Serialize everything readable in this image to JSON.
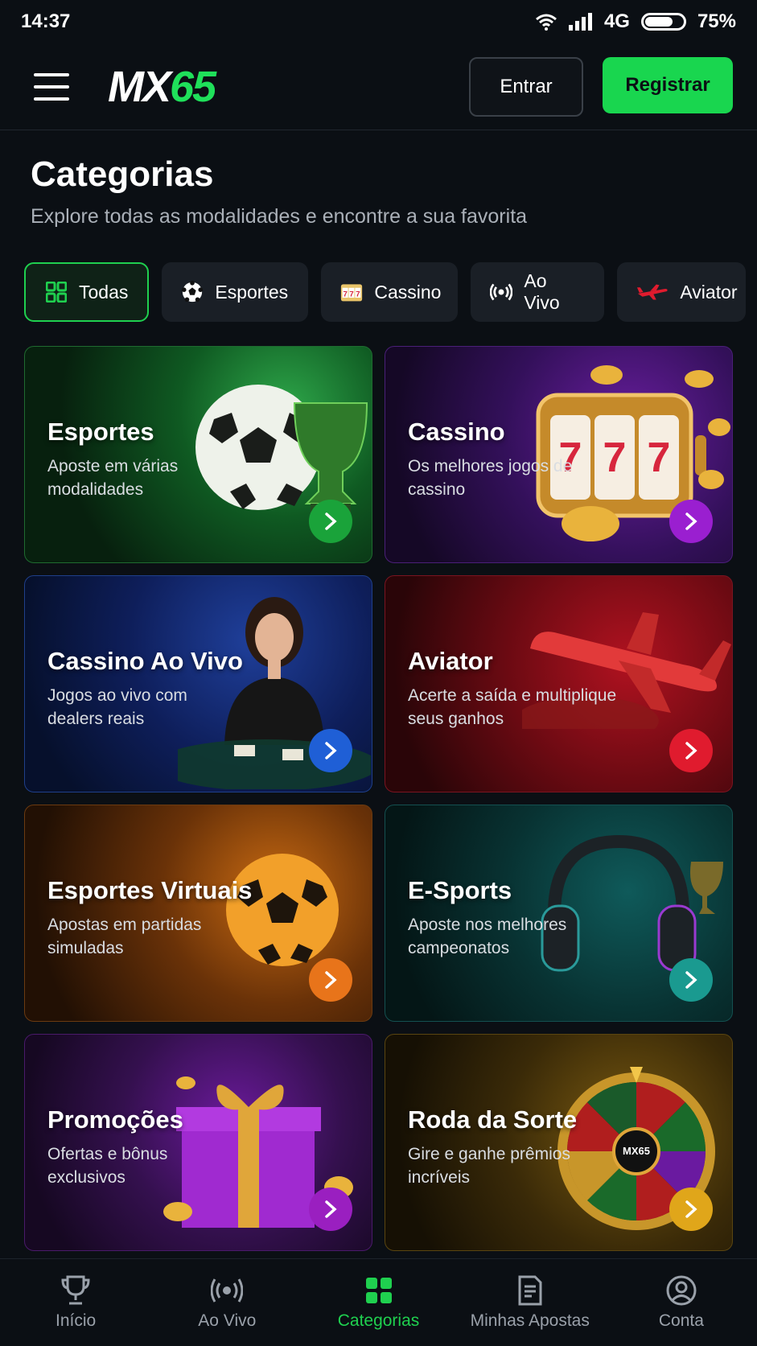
{
  "status_bar": {
    "time": "14:37",
    "network": "4G",
    "battery": "75%"
  },
  "header": {
    "logo_left": "MX",
    "logo_right": "65",
    "login_label": "Entrar",
    "register_label": "Registrar"
  },
  "page": {
    "title": "Categorias",
    "subtitle": "Explore todas as modalidades e encontre a sua favorita"
  },
  "filters": [
    {
      "label": "Todas",
      "icon": "grid-icon",
      "active": true
    },
    {
      "label": "Esportes",
      "icon": "soccer-ball-icon"
    },
    {
      "label": "Cassino",
      "icon": "slot-777-icon"
    },
    {
      "label": "Ao Vivo",
      "icon": "live-broadcast-icon"
    },
    {
      "label": "Aviator",
      "icon": "airplane-icon"
    }
  ],
  "cards": [
    {
      "title": "Esportes",
      "desc": "Aposte em várias modalidades",
      "accent": "#1aa33a"
    },
    {
      "title": "Cassino",
      "desc": "Os melhores jogos de cassino",
      "accent": "#9a1fd0"
    },
    {
      "title": "Cassino Ao Vivo",
      "desc": "Jogos ao vivo com dealers reais",
      "accent": "#1f5fd6"
    },
    {
      "title": "Aviator",
      "desc": "Acerte a saída e multiplique seus ganhos",
      "accent": "#e01b2e"
    },
    {
      "title": "Esportes Virtuais",
      "desc": "Apostas em partidas simuladas",
      "accent": "#e8741a"
    },
    {
      "title": "E-Sports",
      "desc": "Aposte nos melhores campeonatos",
      "accent": "#1a9a90"
    },
    {
      "title": "Promoções",
      "desc": "Ofertas e bônus exclusivos",
      "accent": "#9a1fc0"
    },
    {
      "title": "Roda da Sorte",
      "desc": "Gire e ganhe prêmios incríveis",
      "accent": "#e0a61a"
    }
  ],
  "wheel_logo": "MX65",
  "bottom_nav": [
    {
      "label": "Início",
      "icon": "trophy-icon"
    },
    {
      "label": "Ao Vivo",
      "icon": "live-broadcast-icon"
    },
    {
      "label": "Categorias",
      "icon": "grid-icon",
      "active": true
    },
    {
      "label": "Minhas Apostas",
      "icon": "bet-slip-icon"
    },
    {
      "label": "Conta",
      "icon": "user-circle-icon"
    }
  ]
}
